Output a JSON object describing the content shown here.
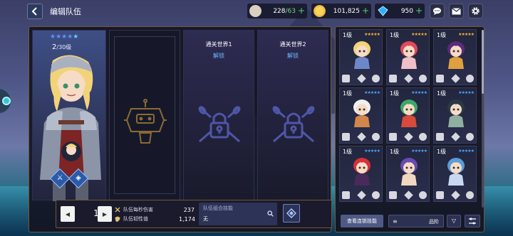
{
  "header": {
    "title": "编辑队伍",
    "resources": [
      {
        "name": "stamina",
        "icon": "coffee-cup-icon",
        "value": "228",
        "max": "/63"
      },
      {
        "name": "gold",
        "icon": "gold-coin-icon",
        "value": "101,825",
        "max": ""
      },
      {
        "name": "gems",
        "icon": "diamond-icon",
        "value": "950",
        "max": ""
      }
    ],
    "buttons": [
      "chat-icon",
      "mail-icon",
      "settings-gear-icon"
    ]
  },
  "team": {
    "leader": {
      "stars": "★★★★",
      "star_last": "★",
      "level": "2",
      "level_cap": "/30",
      "level_suffix": "级"
    },
    "slots": [
      {
        "title": "通关世界1",
        "status": "解锁"
      },
      {
        "title": "通关世界2",
        "status": "解锁"
      }
    ],
    "page": "1",
    "stats": [
      {
        "label": "队伍每秒伤害",
        "value": "237",
        "icon": "crossed-swords-icon"
      },
      {
        "label": "队伍韧性值",
        "value": "1,174",
        "icon": "shield-icon"
      }
    ],
    "combo": {
      "label": "队伍组合技能",
      "value": "无"
    }
  },
  "roster": {
    "cards": [
      {
        "level": "1级",
        "stars": "★★★★★",
        "star_color": "gold",
        "name": "blonde-knight"
      },
      {
        "level": "1级",
        "stars": "★★★★★",
        "star_color": "gold",
        "name": "red-hair-girl"
      },
      {
        "level": "1级",
        "stars": "★★★★★",
        "star_color": "gold",
        "name": "dark-horned"
      },
      {
        "level": "1级",
        "stars": "★★★★★",
        "star_color": "blue",
        "name": "fox-girl"
      },
      {
        "level": "1级",
        "stars": "★★★★★",
        "star_color": "blue",
        "name": "green-dragon"
      },
      {
        "level": "1级",
        "stars": "★★★★★",
        "star_color": "blue",
        "name": "dark-hair-boy"
      },
      {
        "level": "1级",
        "stars": "★★★★★",
        "star_color": "blue",
        "name": "red-cat-girl"
      },
      {
        "level": "1级",
        "stars": "★★★★★",
        "star_color": "blue",
        "name": "purple-mage"
      },
      {
        "level": "1级",
        "stars": "★★★★★",
        "star_color": "blue",
        "name": "blue-winged"
      }
    ],
    "view_combo_label": "查看连锁技能",
    "filter_label": "品阶",
    "colors": {
      "gold_star": "#f0b33c",
      "blue_star": "#4fa2ff",
      "panel_border": "#6d5a3a"
    }
  }
}
